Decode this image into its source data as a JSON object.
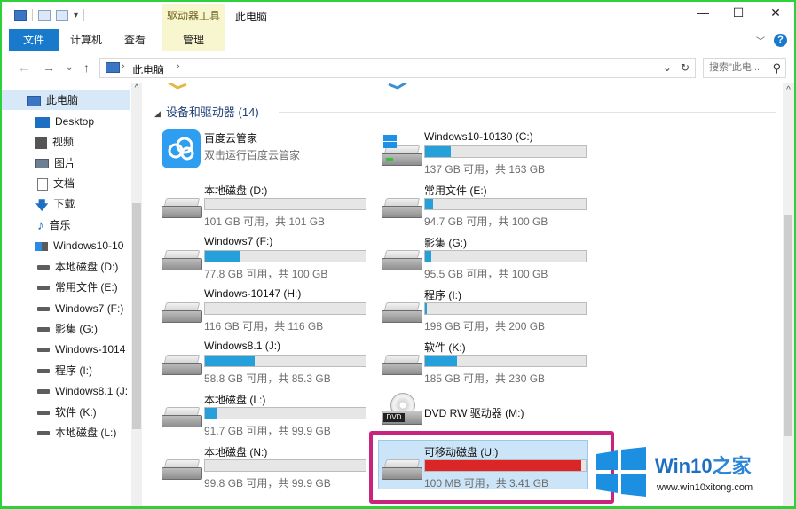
{
  "window": {
    "title": "此电脑",
    "context_tab": "驱动器工具",
    "controls": [
      "—",
      "☐",
      "✕"
    ]
  },
  "ribbon": {
    "tabs": [
      "文件",
      "计算机",
      "查看",
      "管理"
    ]
  },
  "address": {
    "crumb": "此电脑",
    "search_placeholder": "搜索\"此电..."
  },
  "nav": {
    "items": [
      {
        "label": "此电脑",
        "icon": "pc-icon"
      },
      {
        "label": "Desktop",
        "icon": "desktop-icon"
      },
      {
        "label": "视频",
        "icon": "video-icon"
      },
      {
        "label": "图片",
        "icon": "picture-icon"
      },
      {
        "label": "文档",
        "icon": "document-icon"
      },
      {
        "label": "下载",
        "icon": "download-icon"
      },
      {
        "label": "音乐",
        "icon": "music-icon"
      },
      {
        "label": "Windows10-10",
        "icon": "windows-drive-icon"
      },
      {
        "label": "本地磁盘 (D:)",
        "icon": "drive-icon"
      },
      {
        "label": "常用文件 (E:)",
        "icon": "drive-icon"
      },
      {
        "label": "Windows7 (F:)",
        "icon": "drive-icon"
      },
      {
        "label": "影集 (G:)",
        "icon": "drive-icon"
      },
      {
        "label": "Windows-1014",
        "icon": "drive-icon"
      },
      {
        "label": "程序 (I:)",
        "icon": "drive-icon"
      },
      {
        "label": "Windows8.1 (J:",
        "icon": "drive-icon"
      },
      {
        "label": "软件 (K:)",
        "icon": "drive-icon"
      },
      {
        "label": "本地磁盘 (L:)",
        "icon": "drive-icon"
      }
    ]
  },
  "content": {
    "section_title": "设备和驱动器 (14)",
    "baidu": {
      "name": "百度云管家",
      "sub": "双击运行百度云管家"
    },
    "drives": [
      {
        "name": "Windows10-10130 (C:)",
        "cap": "137 GB 可用，共 163 GB",
        "used": 0.16
      },
      {
        "name": "本地磁盘 (D:)",
        "cap": "101 GB 可用，共 101 GB",
        "used": 0.0
      },
      {
        "name": "常用文件 (E:)",
        "cap": "94.7 GB 可用，共 100 GB",
        "used": 0.05
      },
      {
        "name": "Windows7 (F:)",
        "cap": "77.8 GB 可用，共 100 GB",
        "used": 0.22
      },
      {
        "name": "影集 (G:)",
        "cap": "95.5 GB 可用，共 100 GB",
        "used": 0.04
      },
      {
        "name": "Windows-10147 (H:)",
        "cap": "116 GB 可用，共 116 GB",
        "used": 0.0
      },
      {
        "name": "程序 (I:)",
        "cap": "198 GB 可用，共 200 GB",
        "used": 0.01
      },
      {
        "name": "Windows8.1 (J:)",
        "cap": "58.8 GB 可用，共 85.3 GB",
        "used": 0.31
      },
      {
        "name": "软件 (K:)",
        "cap": "185 GB 可用，共 230 GB",
        "used": 0.2
      },
      {
        "name": "本地磁盘 (L:)",
        "cap": "91.7 GB 可用，共 99.9 GB",
        "used": 0.08
      },
      {
        "name": "本地磁盘 (N:)",
        "cap": "99.8 GB 可用，共 99.9 GB",
        "used": 0.0
      }
    ],
    "dvd": {
      "name": "DVD RW 驱动器 (M:)",
      "label": "DVD"
    },
    "removable": {
      "name": "可移动磁盘 (U:)",
      "cap": "100 MB 可用，共 3.41 GB",
      "used": 0.97
    }
  },
  "watermark": {
    "title_main": "Win10",
    "title_accent": "之家",
    "url": "www.win10xitong.com"
  },
  "colors": {
    "accent": "#1979ca",
    "highlight": "#c8237d",
    "bar_fill": "#26a0da",
    "bar_full": "#da2626"
  }
}
